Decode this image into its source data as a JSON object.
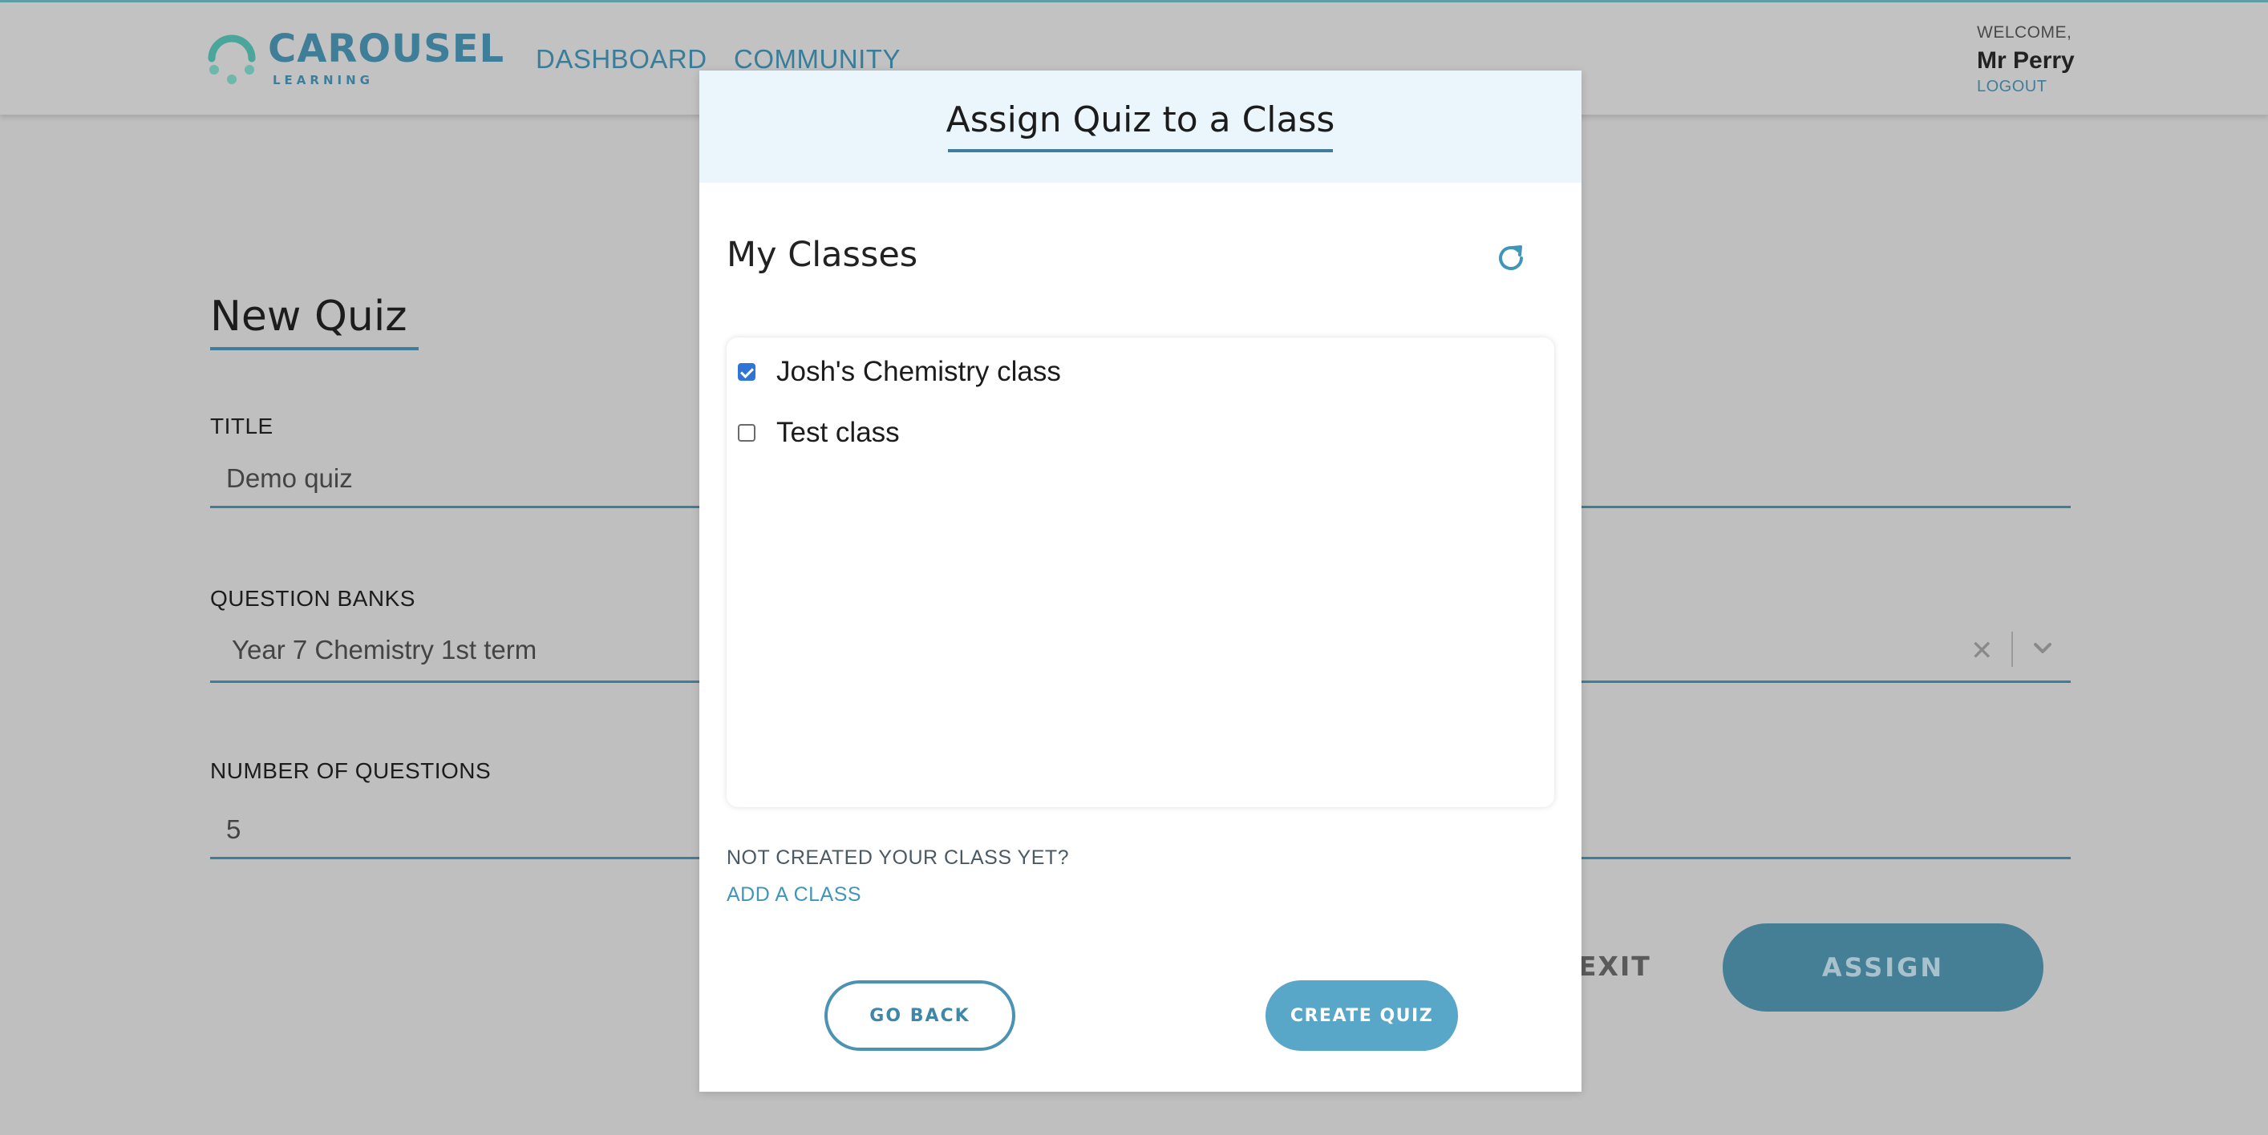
{
  "header": {
    "logo": {
      "name": "CAROUSEL",
      "sub": "LEARNING"
    },
    "nav": [
      {
        "label": "DASHBOARD"
      },
      {
        "label": "COMMUNITY"
      }
    ],
    "welcome_label": "WELCOME,",
    "user_name": "Mr Perry",
    "logout_label": "LOGOUT"
  },
  "page": {
    "title": "New Quiz",
    "fields": {
      "title": {
        "label": "TITLE",
        "value": "Demo quiz"
      },
      "question_banks": {
        "label": "QUESTION BANKS",
        "value": "Year 7 Chemistry 1st term"
      },
      "number_of_questions": {
        "label": "NUMBER OF QUESTIONS",
        "value": "5"
      }
    },
    "exit_label": "EXIT",
    "assign_label": "ASSIGN"
  },
  "modal": {
    "title": "Assign Quiz to a Class",
    "section_title": "My Classes",
    "classes": [
      {
        "label": "Josh's Chemistry class",
        "checked": true
      },
      {
        "label": "Test class",
        "checked": false
      }
    ],
    "not_created_text": "NOT CREATED YOUR CLASS YET?",
    "add_class_label": "ADD A CLASS",
    "go_back_label": "GO BACK",
    "create_quiz_label": "CREATE QUIZ"
  },
  "colors": {
    "accent": "#3f7e99",
    "button_primary": "#58a7c9",
    "checkbox_checked": "#2f74d6",
    "modal_header_bg": "#eaf6fc",
    "overlay_bg": "#bfbfbf"
  },
  "icons": {
    "logo": "carousel-logo-icon",
    "clear": "close-icon",
    "dropdown": "chevron-down-icon",
    "refresh": "refresh-icon",
    "checked": "checkbox-checked-icon",
    "unchecked": "checkbox-unchecked-icon"
  }
}
